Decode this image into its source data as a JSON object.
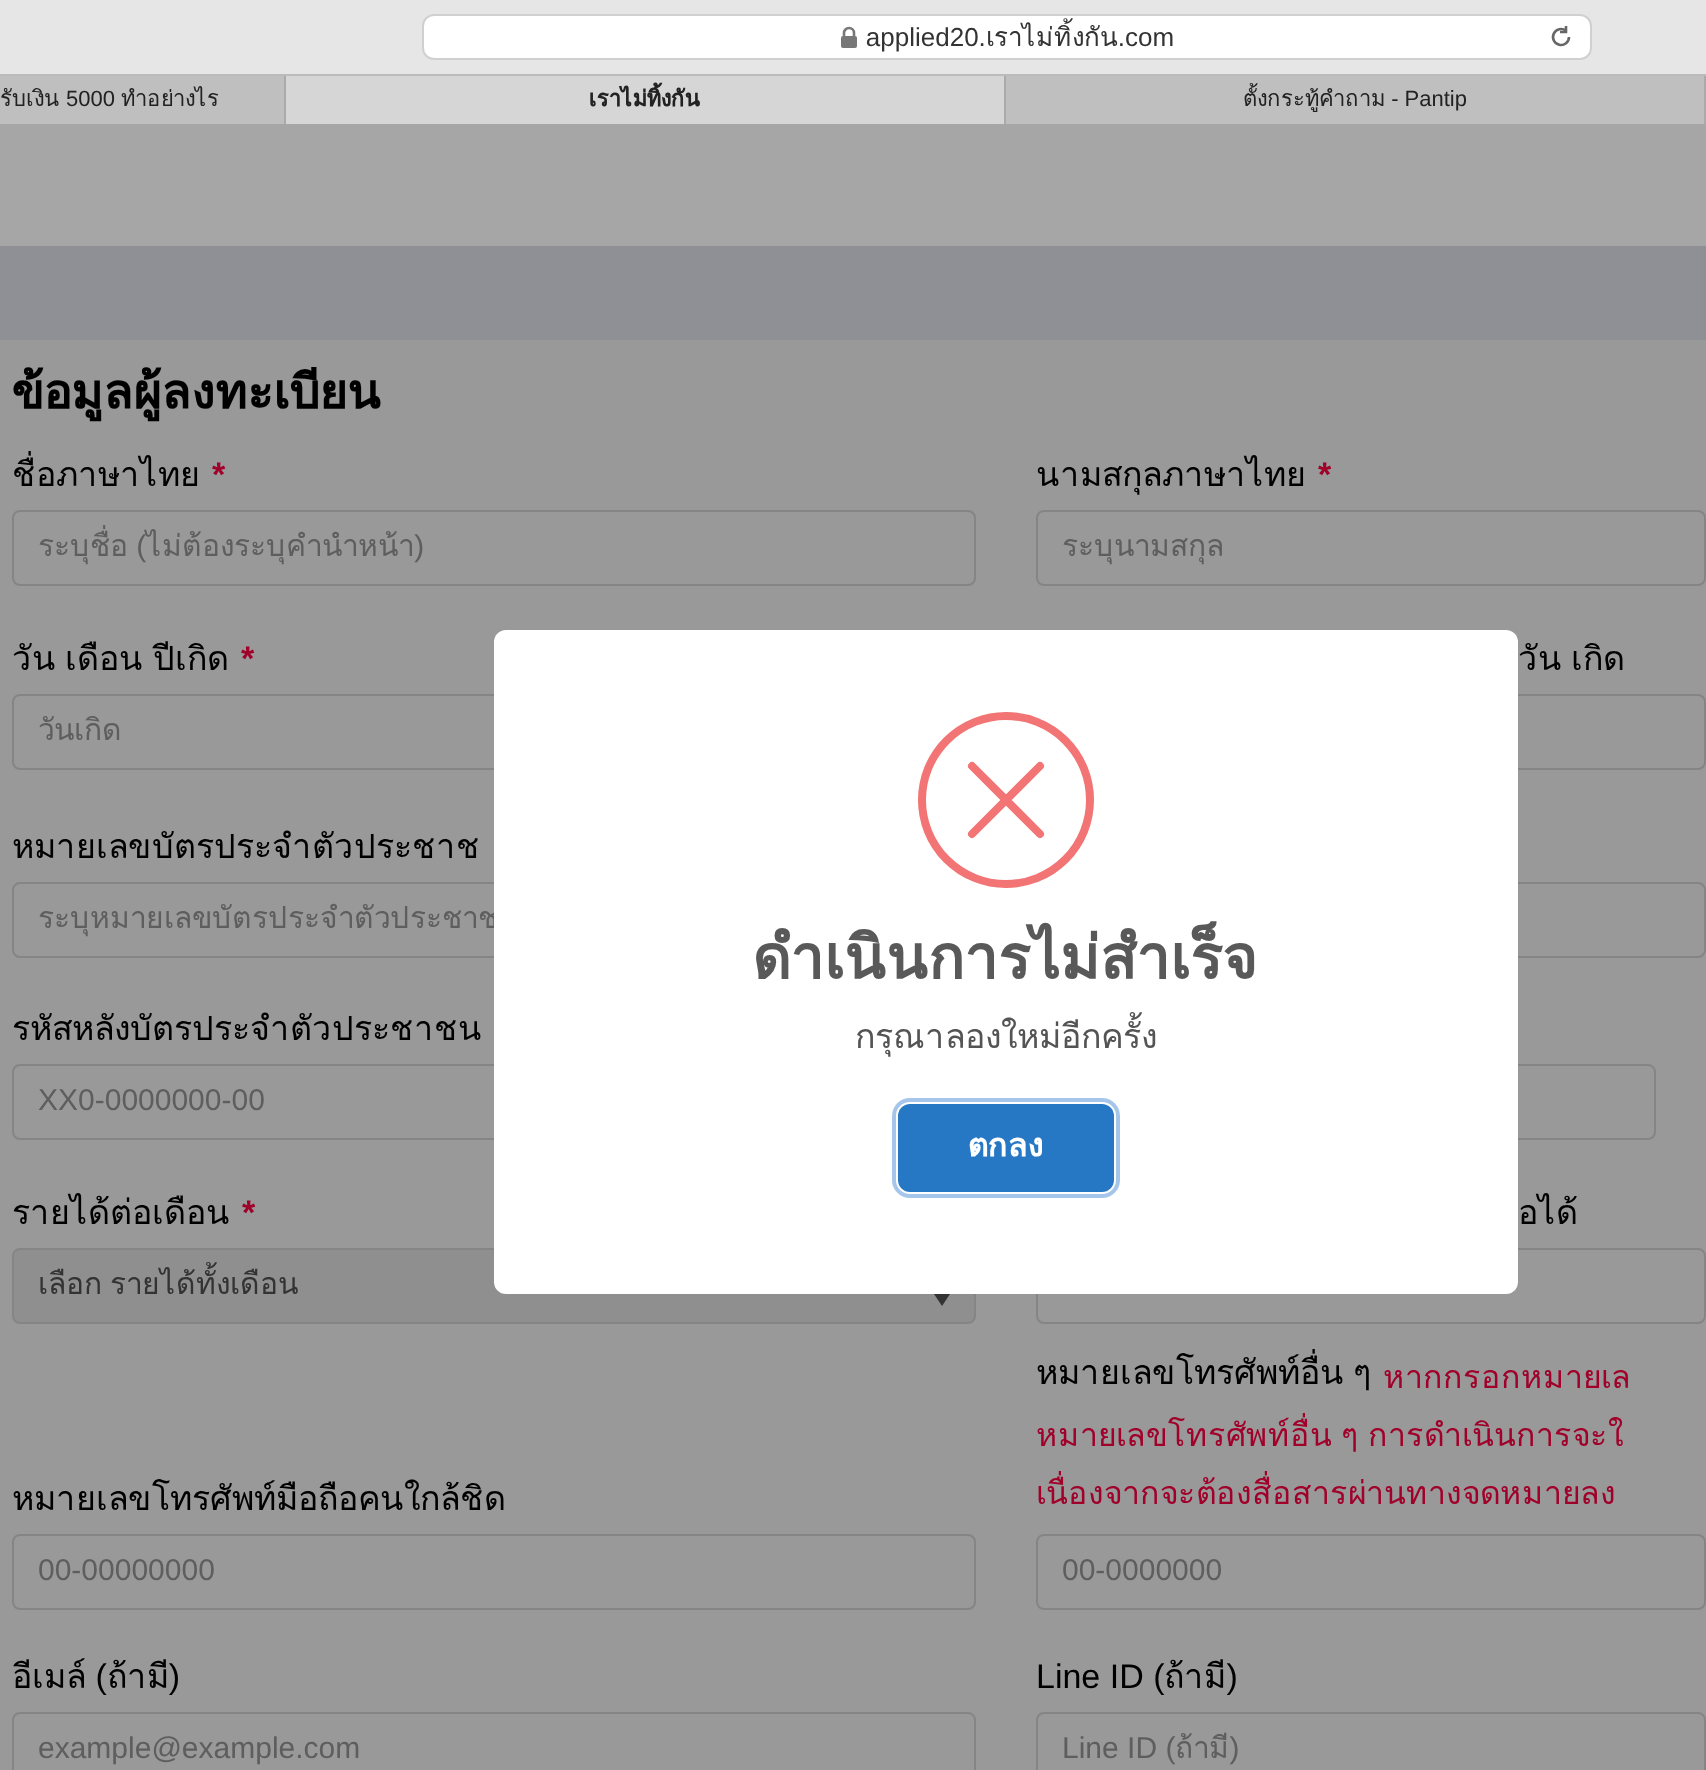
{
  "browser": {
    "url": "applied20.เราไม่ทิ้งกัน.com",
    "tabs": [
      {
        "label": "รับเงิน 5000 ทำอย่างไร",
        "selected": false
      },
      {
        "label": "เราไม่ทิ้งกัน",
        "selected": true
      },
      {
        "label": "ตั้งกระทู้คำถาม - Pantip",
        "selected": false
      }
    ]
  },
  "form": {
    "title": "ข้อมูลผู้ลงทะเบียน",
    "rows": [
      {
        "left": {
          "label": "ชื่อภาษาไทย",
          "required_mark": "*",
          "kind": "input",
          "placeholder": "ระบุชื่อ (ไม่ต้องระบุคำนำหน้า)"
        },
        "right": {
          "label": "นามสกุลภาษาไทย",
          "required_mark": "*",
          "kind": "input",
          "placeholder": "ระบุนามสกุล"
        }
      },
      {
        "left": {
          "label": "วัน เดือน ปีเกิด",
          "required_mark": "*",
          "kind": "input",
          "placeholder": "วันเกิด"
        },
        "right": {
          "label": "วัน เกิด",
          "kind": "input"
        }
      },
      {
        "left": {
          "label": "หมายเลขบัตรประจำตัวประชาช",
          "kind": "input",
          "placeholder": "ระบุหมายเลขบัตรประจำตัวประชาช"
        },
        "right": {
          "kind": "input"
        }
      },
      {
        "left": {
          "label": "รหัสหลังบัตรประจำตัวประชาชน",
          "kind": "input",
          "placeholder": "XX0-0000000-00"
        },
        "right": {
          "kind": "input"
        }
      },
      {
        "left": {
          "label": "รายได้ต่อเดือน",
          "required_mark": "*",
          "kind": "select",
          "placeholder": "เลือก รายได้ทั้งเดือน"
        },
        "right": {
          "label": "อได้",
          "kind": "input"
        }
      },
      {
        "left": {
          "label": "หมายเลขโทรศัพท์มือถือคนใกล้ชิด",
          "kind": "input",
          "placeholder": "00-00000000"
        },
        "right": {
          "label": "หมายเลขโทรศัพท์อื่น ๆ",
          "note": [
            "หากกรอกหมายเล",
            "หมายเลขโทรศัพท์อื่น ๆ การดำเนินการจะใ",
            "เนื่องจากจะต้องสื่อสารผ่านทางจดหมายลง"
          ],
          "kind": "input",
          "placeholder": "00-0000000"
        }
      },
      {
        "left": {
          "label": "อีเมล์ (ถ้ามี)",
          "kind": "input",
          "placeholder": "example@example.com"
        },
        "right": {
          "label": "Line ID (ถ้ามี)",
          "kind": "input",
          "placeholder": "Line ID (ถ้ามี)"
        }
      }
    ]
  },
  "dialog": {
    "title": "ดำเนินการไม่สำเร็จ",
    "message": "กรุณาลองใหม่อีกครั้ง",
    "button": "ตกลง"
  }
}
